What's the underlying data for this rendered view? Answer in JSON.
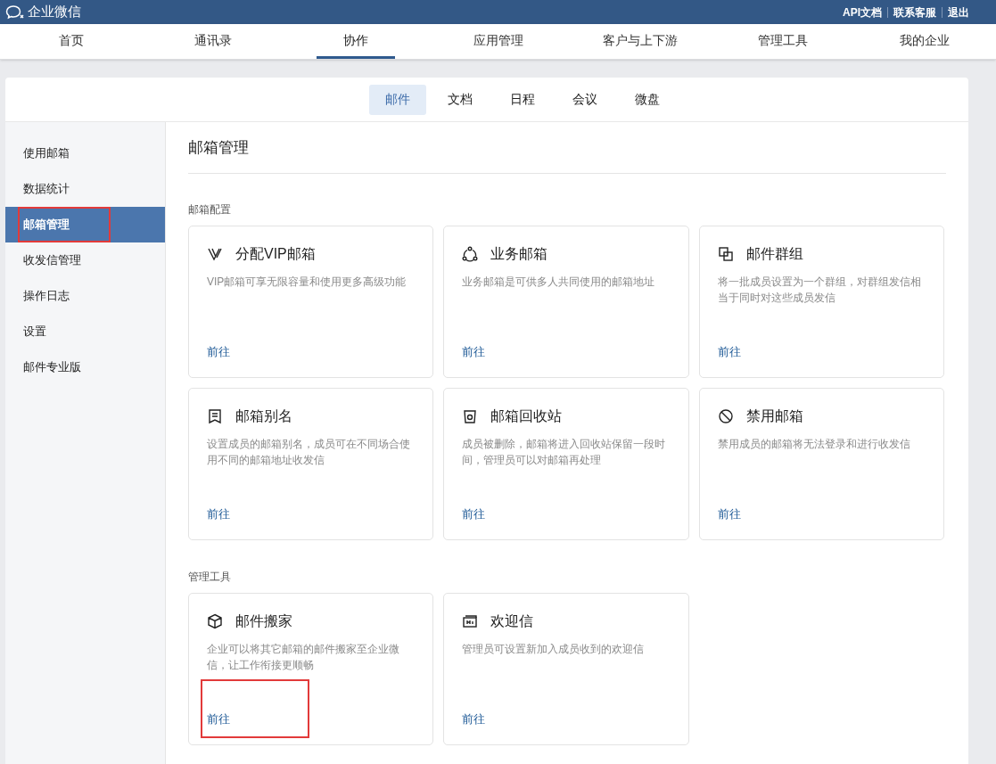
{
  "top_bar": {
    "brand": "企业微信",
    "links": [
      "API文档",
      "联系客服",
      "退出"
    ]
  },
  "nav": [
    {
      "label": "首页",
      "selected": false
    },
    {
      "label": "通讯录",
      "selected": false
    },
    {
      "label": "协作",
      "selected": true
    },
    {
      "label": "应用管理",
      "selected": false
    },
    {
      "label": "客户与上下游",
      "selected": false
    },
    {
      "label": "管理工具",
      "selected": false
    },
    {
      "label": "我的企业",
      "selected": false
    }
  ],
  "sub_tabs": [
    {
      "label": "邮件",
      "selected": true
    },
    {
      "label": "文档",
      "selected": false
    },
    {
      "label": "日程",
      "selected": false
    },
    {
      "label": "会议",
      "selected": false
    },
    {
      "label": "微盘",
      "selected": false
    }
  ],
  "sidebar": {
    "items": [
      {
        "label": "使用邮箱",
        "selected": false,
        "annotated": false
      },
      {
        "label": "数据统计",
        "selected": false,
        "annotated": false
      },
      {
        "label": "邮箱管理",
        "selected": true,
        "annotated": true
      },
      {
        "label": "收发信管理",
        "selected": false,
        "annotated": false
      },
      {
        "label": "操作日志",
        "selected": false,
        "annotated": false
      },
      {
        "label": "设置",
        "selected": false,
        "annotated": false
      },
      {
        "label": "邮件专业版",
        "selected": false,
        "annotated": false
      }
    ]
  },
  "page_title": "邮箱管理",
  "sections": [
    {
      "title": "邮箱配置",
      "cards": [
        {
          "kind": "vip",
          "title": "分配VIP邮箱",
          "description": "VIP邮箱可享无限容量和使用更多高级功能",
          "link": "前往",
          "annotated": false
        },
        {
          "kind": "share",
          "title": "业务邮箱",
          "description": "业务邮箱是可供多人共同使用的邮箱地址",
          "link": "前往",
          "annotated": false
        },
        {
          "kind": "group",
          "title": "邮件群组",
          "description": "将一批成员设置为一个群组，对群组发信相当于同时对这些成员发信",
          "link": "前往",
          "annotated": false
        },
        {
          "kind": "alias",
          "title": "邮箱别名",
          "description": "设置成员的邮箱别名，成员可在不同场合使用不同的邮箱地址收发信",
          "link": "前往",
          "annotated": false
        },
        {
          "kind": "trash",
          "title": "邮箱回收站",
          "description": "成员被删除，邮箱将进入回收站保留一段时间，管理员可以对邮箱再处理",
          "link": "前往",
          "annotated": false
        },
        {
          "kind": "ban",
          "title": "禁用邮箱",
          "description": "禁用成员的邮箱将无法登录和进行收发信",
          "link": "前往",
          "annotated": false
        }
      ]
    },
    {
      "title": "管理工具",
      "cards": [
        {
          "kind": "box",
          "title": "邮件搬家",
          "description": "企业可以将其它邮箱的邮件搬家至企业微信，让工作衔接更顺畅",
          "link": "前往",
          "annotated": true
        },
        {
          "kind": "welcome",
          "title": "欢迎信",
          "description": "管理员可设置新加入成员收到的欢迎信",
          "link": "前往",
          "annotated": false
        }
      ]
    }
  ]
}
